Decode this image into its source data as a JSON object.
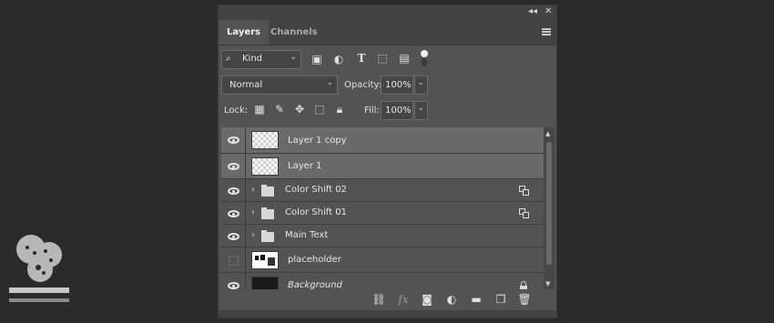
{
  "panel": {
    "collapse_icon": "double-chevron-left-icon",
    "close_icon": "close-icon",
    "collapse_glyph": "◂◂",
    "close_glyph": "✕",
    "tabs": [
      {
        "label": "Layers",
        "active": true
      },
      {
        "label": "Channels",
        "active": false
      }
    ],
    "menu_icon": "panel-menu-icon"
  },
  "filter": {
    "kind_label": "Kind",
    "filter_icons": [
      "pixel-layer-filter-icon",
      "adjustment-layer-filter-icon",
      "type-layer-filter-icon",
      "shape-layer-filter-icon",
      "smart-object-filter-icon"
    ],
    "toggle_icon": "filter-toggle-icon"
  },
  "blend": {
    "mode": "Normal",
    "opacity_label": "Opacity:",
    "opacity_value": "100%"
  },
  "lock": {
    "label": "Lock:",
    "lock_icons": [
      "lock-transparent-pixels-icon",
      "lock-image-pixels-icon",
      "lock-position-icon",
      "lock-artboard-icon",
      "lock-all-icon"
    ],
    "fill_label": "Fill:",
    "fill_value": "100%"
  },
  "layers": [
    {
      "name": "Layer 1 copy",
      "visible": true,
      "selected": true,
      "type": "pixel"
    },
    {
      "name": "Layer 1",
      "visible": true,
      "selected": true,
      "type": "pixel"
    },
    {
      "name": "Color Shift 02",
      "visible": true,
      "selected": false,
      "type": "group",
      "badge": "smart-filter-icon"
    },
    {
      "name": "Color Shift 01",
      "visible": true,
      "selected": false,
      "type": "group",
      "badge": "smart-filter-icon"
    },
    {
      "name": "Main Text",
      "visible": true,
      "selected": false,
      "type": "group"
    },
    {
      "name": "placeholder",
      "visible": false,
      "selected": false,
      "type": "smart-object"
    },
    {
      "name": "Background",
      "visible": true,
      "selected": false,
      "type": "background",
      "locked": true
    }
  ],
  "bottom_icons": [
    {
      "name": "link-layers-icon",
      "glyph": "⛓"
    },
    {
      "name": "fx-icon",
      "glyph": "fx"
    },
    {
      "name": "add-mask-icon",
      "glyph": "◙"
    },
    {
      "name": "new-adjustment-layer-icon",
      "glyph": "◐"
    },
    {
      "name": "new-group-icon",
      "glyph": "▬"
    },
    {
      "name": "new-layer-icon",
      "glyph": "❐"
    },
    {
      "name": "delete-layer-icon",
      "glyph": "🗑"
    }
  ],
  "colors": {
    "background": "#2b2b2b",
    "panel": "#535353",
    "selected_row": "#6a6a6a"
  }
}
